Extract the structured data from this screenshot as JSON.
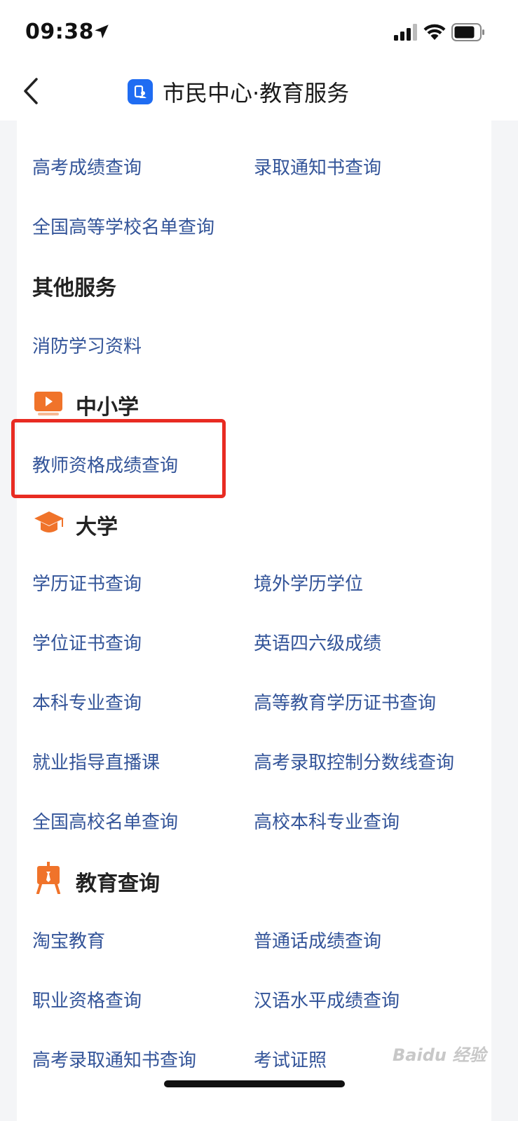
{
  "status_bar": {
    "time": "09:38"
  },
  "nav": {
    "title": "市民中心·教育服务"
  },
  "sections": {
    "top_items": [
      "高考成绩查询",
      "录取通知书查询",
      "全国高等学校名单查询"
    ],
    "other_services": {
      "heading": "其他服务",
      "items": [
        "消防学习资料"
      ]
    },
    "middle_school": {
      "heading": "中小学",
      "items": [
        "教师资格成绩查询"
      ]
    },
    "university": {
      "heading": "大学",
      "items": [
        "学历证书查询",
        "境外学历学位",
        "学位证书查询",
        "英语四六级成绩",
        "本科专业查询",
        "高等教育学历证书查询",
        "就业指导直播课",
        "高考录取控制分数线查询",
        "全国高校名单查询",
        "高校本科专业查询"
      ]
    },
    "education_query": {
      "heading": "教育查询",
      "items": [
        "淘宝教育",
        "普通话成绩查询",
        "职业资格查询",
        "汉语水平成绩查询",
        "高考录取通知书查询",
        "考试证照"
      ]
    }
  },
  "watermark": {
    "text": "Baidu 经验"
  },
  "colors": {
    "link": "#335499",
    "highlight": "#e82b22",
    "accent_orange": "#f0732a",
    "app_blue": "#1f6cf2"
  }
}
